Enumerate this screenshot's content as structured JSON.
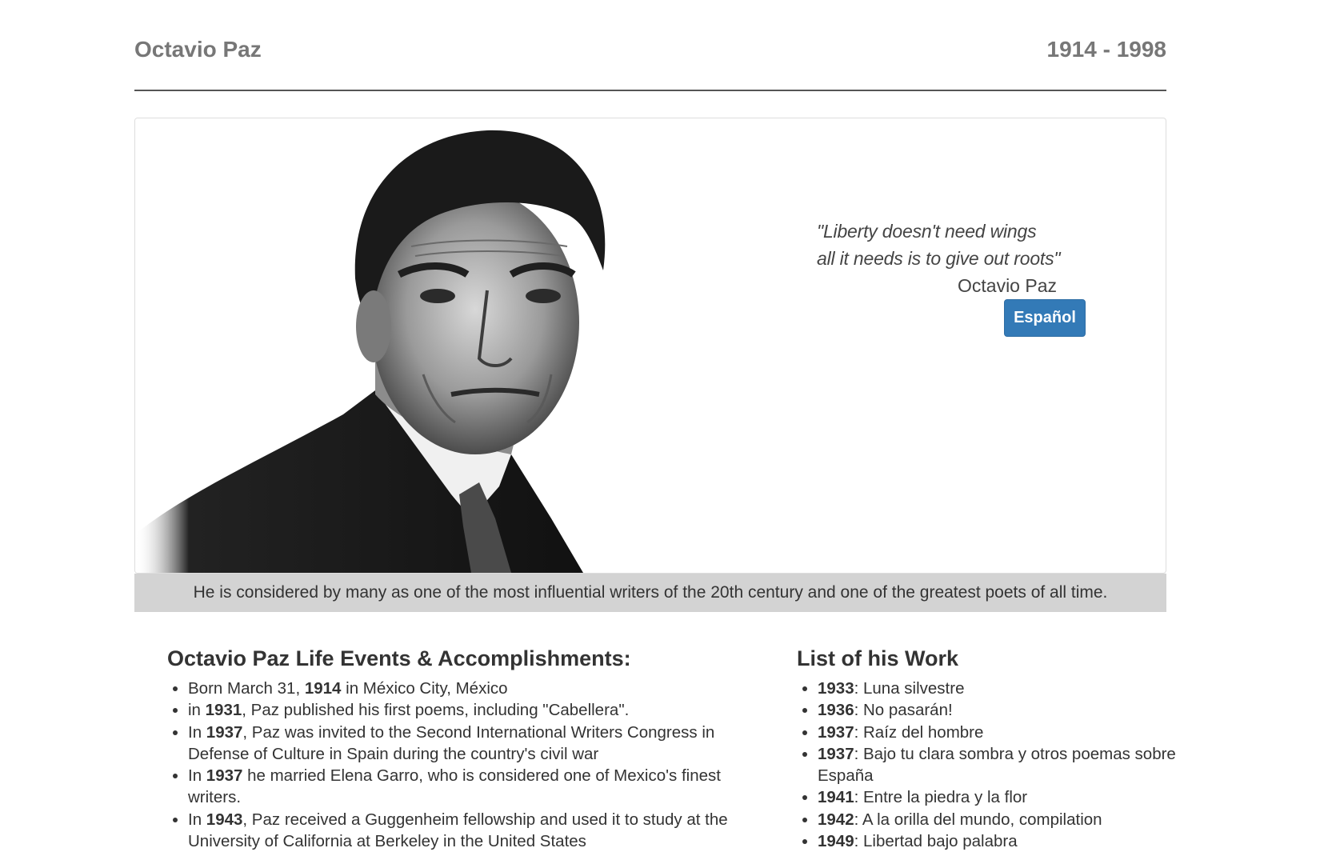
{
  "header": {
    "name": "Octavio Paz",
    "years": "1914 - 1998"
  },
  "hero": {
    "quote_line1": "\"Liberty doesn't need wings",
    "quote_line2": "all it needs is to give out roots\"",
    "quote_author": "Octavio Paz",
    "button_label": "Español",
    "caption": "He is considered by many as one of the most influential writers of the 20th century and one of the greatest poets of all time."
  },
  "life": {
    "title": "Octavio Paz Life Events & Accomplishments:",
    "items": [
      {
        "pre": "Born March 31, ",
        "bold": "1914",
        "post": " in México City, México"
      },
      {
        "pre": "in ",
        "bold": "1931",
        "post": ", Paz published his first poems, including \"Cabellera\"."
      },
      {
        "pre": "In ",
        "bold": "1937",
        "post": ", Paz was invited to the Second International Writers Congress in Defense of Culture in Spain during the country's civil war"
      },
      {
        "pre": "In ",
        "bold": "1937",
        "post": " he married Elena Garro, who is considered one of Mexico's finest writers."
      },
      {
        "pre": "In ",
        "bold": "1943",
        "post": ", Paz received a Guggenheim fellowship and used it to study at the University of California at Berkeley in the United States"
      }
    ]
  },
  "works": {
    "title": "List of his Work",
    "items": [
      {
        "year": "1933",
        "title": ": Luna silvestre"
      },
      {
        "year": "1936",
        "title": ": No pasarán!"
      },
      {
        "year": "1937",
        "title": ": Raíz del hombre"
      },
      {
        "year": "1937",
        "title": ": Bajo tu clara sombra y otros poemas sobre España"
      },
      {
        "year": "1941",
        "title": ": Entre la piedra y la flor"
      },
      {
        "year": "1942",
        "title": ": A la orilla del mundo, compilation"
      },
      {
        "year": "1949",
        "title": ": Libertad bajo palabra"
      }
    ]
  },
  "colors": {
    "button": "#337ab7",
    "caption_bg": "#d3d3d3",
    "header_text": "#777777"
  }
}
